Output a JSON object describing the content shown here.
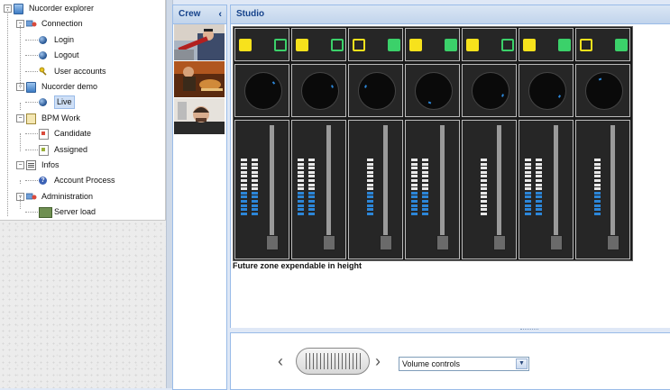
{
  "tree": {
    "items": [
      {
        "label": "Nucorder explorer",
        "icon": "book-icon",
        "level": 0,
        "expanded": true
      },
      {
        "label": "Connection",
        "icon": "network-icon",
        "level": 1,
        "expanded": true
      },
      {
        "label": "Login",
        "icon": "globe-icon",
        "level": 2
      },
      {
        "label": "Logout",
        "icon": "globe-icon",
        "level": 2
      },
      {
        "label": "User accounts",
        "icon": "keys-icon",
        "level": 2
      },
      {
        "label": "Nucorder demo",
        "icon": "book-icon",
        "level": 1,
        "expanded": true
      },
      {
        "label": "Live",
        "icon": "globe-icon",
        "level": 2,
        "selected": true
      },
      {
        "label": "BPM Work",
        "icon": "document-icon",
        "level": 1,
        "expanded": true
      },
      {
        "label": "Candidate",
        "icon": "document-icon",
        "level": 2
      },
      {
        "label": "Assigned",
        "icon": "document-icon",
        "level": 2
      },
      {
        "label": "Infos",
        "icon": "list-icon",
        "level": 1,
        "expanded": true
      },
      {
        "label": "Account Process",
        "icon": "help-icon",
        "level": 2
      },
      {
        "label": "Administration",
        "icon": "network-icon",
        "level": 1,
        "expanded": true
      },
      {
        "label": "Server load",
        "icon": "monitor-icon",
        "level": 2
      }
    ]
  },
  "crew": {
    "title": "Crew",
    "collapse_glyph": "‹",
    "members": [
      "crew-member-1",
      "crew-member-2",
      "crew-member-3"
    ]
  },
  "studio": {
    "title": "Studio",
    "future_zone_text": "Future zone expendable in height"
  },
  "mixer": {
    "colors": {
      "yellow": "#f7e21c",
      "green": "#3bd16a",
      "meter": "#2c86d8",
      "meter_off": "#e8e8e8"
    },
    "channels": [
      {
        "left_filled": true,
        "right_filled": false,
        "knob_angle": 50,
        "fader_level": 0.0,
        "meter_bars": 2,
        "meter_level": 0.45
      },
      {
        "left_filled": true,
        "right_filled": false,
        "knob_angle": 70,
        "fader_level": 0.0,
        "meter_bars": 2,
        "meter_level": 0.45
      },
      {
        "left_filled": false,
        "right_filled": true,
        "knob_angle": -70,
        "fader_level": 0.0,
        "meter_bars": 1,
        "meter_level": 0.45
      },
      {
        "left_filled": true,
        "right_filled": true,
        "knob_angle": 200,
        "fader_level": 0.0,
        "meter_bars": 2,
        "meter_level": 0.45
      },
      {
        "left_filled": true,
        "right_filled": false,
        "knob_angle": 110,
        "fader_level": 0.0,
        "meter_bars": 1,
        "meter_level": 0.0
      },
      {
        "left_filled": true,
        "right_filled": true,
        "knob_angle": 115,
        "fader_level": 0.0,
        "meter_bars": 2,
        "meter_level": 0.45
      },
      {
        "left_filled": false,
        "right_filled": true,
        "knob_angle": -20,
        "fader_level": 0.0,
        "meter_bars": 1,
        "meter_level": 0.45
      }
    ]
  },
  "controls": {
    "left_arrow": "‹",
    "right_arrow": "›",
    "mode_selected": "Volume controls"
  }
}
